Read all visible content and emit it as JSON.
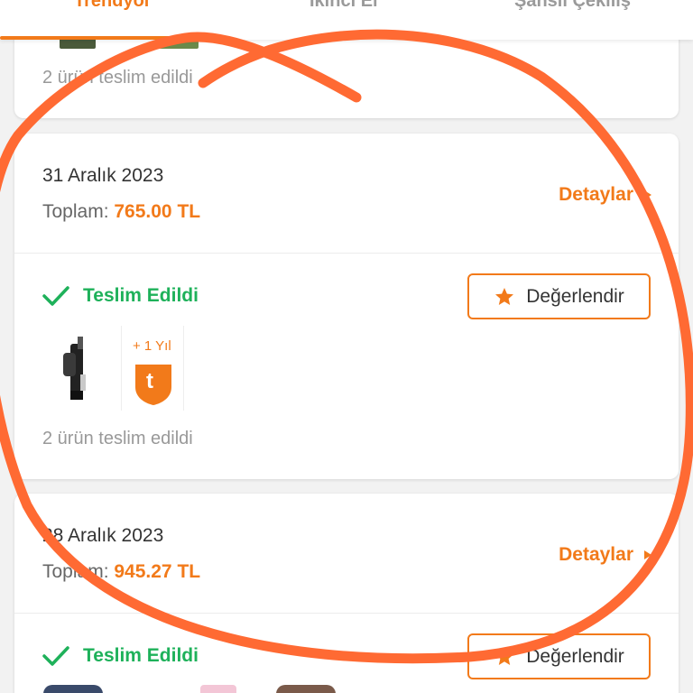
{
  "tabs": [
    {
      "label": "Trendyol"
    },
    {
      "label": "İkinci El"
    },
    {
      "label": "Şanslı Çekiliş"
    }
  ],
  "orders": [
    {
      "delivered_count_text": "2 ürün teslim edildi"
    },
    {
      "date": "31 Aralık 2023",
      "total_label": "Toplam:",
      "total_value": "765.00 TL",
      "details_label": "Detaylar",
      "status": "Teslim Edildi",
      "rate_label": "Değerlendir",
      "warranty_label": "+ 1 Yıl",
      "warranty_letter": "t",
      "delivered_count_text": "2 ürün teslim edildi"
    },
    {
      "date": "28 Aralık 2023",
      "total_label": "Toplam:",
      "total_value": "945.27 TL",
      "details_label": "Detaylar",
      "status": "Teslim Edildi",
      "rate_label": "Değerlendir"
    }
  ],
  "colors": {
    "accent": "#f27a1a",
    "success": "#1eb15a",
    "annotation_stroke": "#ff6a33"
  }
}
